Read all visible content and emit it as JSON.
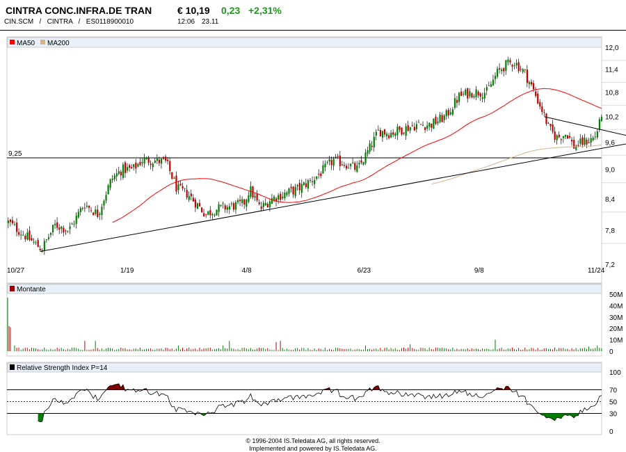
{
  "header": {
    "name": "CINTRA CONC.INFRA.DE TRAN",
    "price": "€ 10,19",
    "change": "0,23",
    "change_pct": "+2,31%",
    "ids": "CIN.SCM   /   CINTRA   /   ES0118900010",
    "time": "12:06",
    "date": "23.11"
  },
  "colors": {
    "up": "#008000",
    "down": "#c00000",
    "ma50": "#ff0000",
    "ma200": "#d2b48c",
    "rsi_high": "#800000",
    "rsi_low": "#008000",
    "strip": "#e8f0fa"
  },
  "chart_data": [
    {
      "type": "candlestick",
      "title": "Price",
      "legend": [
        {
          "name": "MA50",
          "color": "#ff0000"
        },
        {
          "name": "MA200",
          "color": "#d2b48c"
        }
      ],
      "x_unit": "days since 10/27",
      "x_ticks": [
        {
          "day": 0,
          "label": "10/27"
        },
        {
          "day": 84,
          "label": "1/19"
        },
        {
          "day": 164,
          "label": "4/8"
        },
        {
          "day": 240,
          "label": "6/23"
        },
        {
          "day": 317,
          "label": "9/8"
        },
        {
          "day": 394,
          "label": "11/24"
        }
      ],
      "y_ticks": [
        "12,0",
        "11,4",
        "10,8",
        "10,2",
        "9,6",
        "9,0",
        "8,4",
        "7,8",
        "7,2"
      ],
      "y_tick_values": [
        12.0,
        11.4,
        10.8,
        10.2,
        9.6,
        9.0,
        8.4,
        7.8,
        7.2
      ],
      "ylim": [
        7.2,
        12.0
      ],
      "y_scale": "log",
      "close_waypoints": [
        [
          7,
          7.95
        ],
        [
          29,
          7.46
        ],
        [
          38,
          7.9
        ],
        [
          47,
          7.8
        ],
        [
          57,
          8.3
        ],
        [
          66,
          8.1
        ],
        [
          75,
          8.8
        ],
        [
          82,
          9.0
        ],
        [
          89,
          9.0
        ],
        [
          95,
          9.2
        ],
        [
          102,
          9.2
        ],
        [
          111,
          9.15
        ],
        [
          118,
          8.6
        ],
        [
          125,
          8.5
        ],
        [
          137,
          8.1
        ],
        [
          144,
          8.2
        ],
        [
          153,
          8.25
        ],
        [
          162,
          8.3
        ],
        [
          166,
          8.6
        ],
        [
          173,
          8.2
        ],
        [
          180,
          8.4
        ],
        [
          189,
          8.5
        ],
        [
          198,
          8.6
        ],
        [
          208,
          8.8
        ],
        [
          215,
          9.0
        ],
        [
          221,
          9.2
        ],
        [
          231,
          9.1
        ],
        [
          237,
          9.0
        ],
        [
          244,
          9.4
        ],
        [
          251,
          9.86
        ],
        [
          258,
          9.8
        ],
        [
          267,
          9.9
        ],
        [
          276,
          10.0
        ],
        [
          285,
          10.0
        ],
        [
          295,
          10.2
        ],
        [
          304,
          10.7
        ],
        [
          313,
          10.8
        ],
        [
          322,
          10.8
        ],
        [
          329,
          11.3
        ],
        [
          334,
          11.5
        ],
        [
          340,
          11.6
        ],
        [
          347,
          11.3
        ],
        [
          352,
          10.9
        ],
        [
          359,
          10.3
        ],
        [
          363,
          9.9
        ],
        [
          368,
          9.7
        ],
        [
          375,
          9.8
        ],
        [
          379,
          9.5
        ],
        [
          386,
          9.6
        ],
        [
          393,
          9.7
        ],
        [
          398,
          10.19
        ]
      ],
      "horizontal_line": {
        "value": 9.25,
        "label": "9,25"
      },
      "trendlines": [
        {
          "name": "support",
          "points": [
            [
              28,
              7.42
            ],
            [
              414,
              9.56
            ]
          ]
        },
        {
          "name": "resistance",
          "points": [
            [
              360,
              10.19
            ],
            [
              414,
              9.75
            ]
          ]
        }
      ],
      "moving_averages": [
        50,
        200
      ]
    },
    {
      "type": "bar",
      "title": "Montante",
      "y_ticks": [
        "50M",
        "40M",
        "30M",
        "20M",
        "10M",
        "0"
      ],
      "ylim": [
        0,
        50
      ],
      "unit": "M",
      "spikes": [
        [
          0,
          47
        ],
        [
          1,
          22
        ],
        [
          2,
          21
        ],
        [
          3,
          5
        ],
        [
          36,
          9
        ],
        [
          41,
          9
        ],
        [
          80,
          5
        ],
        [
          101,
          5
        ],
        [
          104,
          9
        ],
        [
          126,
          8
        ],
        [
          128,
          9
        ],
        [
          168,
          5
        ],
        [
          189,
          6
        ],
        [
          229,
          10
        ],
        [
          273,
          4
        ],
        [
          277,
          5
        ],
        [
          284,
          4
        ],
        [
          344,
          5
        ],
        [
          366,
          4
        ],
        [
          373,
          6
        ],
        [
          384,
          4
        ],
        [
          397,
          4
        ]
      ]
    },
    {
      "type": "line",
      "title": "Relative Strength Index P=14",
      "y_ticks": [
        "100",
        "70",
        "50",
        "30",
        "0"
      ],
      "ylim": [
        0,
        100
      ],
      "levels": [
        70,
        50,
        30
      ]
    }
  ],
  "footer": {
    "line1": "© 1996-2004 IS.Teledata AG, all rights reserved.",
    "line2": "Implemented and powered by IS.Teledata AG."
  }
}
